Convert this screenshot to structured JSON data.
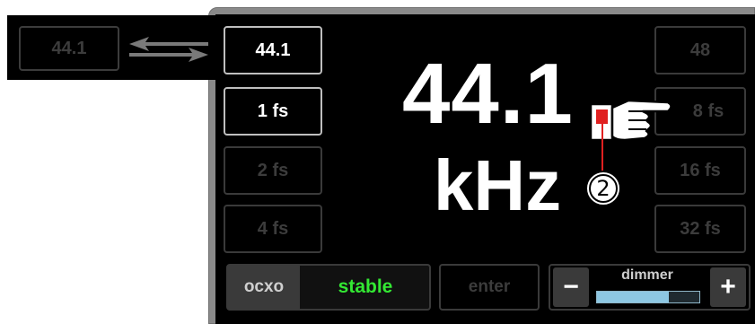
{
  "callout": {
    "source_rate": "44.1"
  },
  "rate_buttons_left": [
    {
      "label": "44.1",
      "state": "active"
    },
    {
      "label": "1 fs",
      "state": "active"
    },
    {
      "label": "2 fs",
      "state": "dim"
    },
    {
      "label": "4 fs",
      "state": "dim"
    }
  ],
  "rate_buttons_right": [
    {
      "label": "48",
      "state": "dim"
    },
    {
      "label": "8 fs",
      "state": "dim"
    },
    {
      "label": "16 fs",
      "state": "dim"
    },
    {
      "label": "32 fs",
      "state": "dim"
    }
  ],
  "display": {
    "frequency": "44.1",
    "unit": "kHz"
  },
  "bottom_bar": {
    "ocxo_label": "ocxo",
    "ocxo_status": "stable",
    "enter_label": "enter",
    "dimmer_label": "dimmer",
    "minus_label": "−",
    "plus_label": "+",
    "dimmer_level": 0.7
  },
  "annotation": {
    "step_number": "2"
  },
  "colors": {
    "status_ok": "#33e833",
    "dimmer_fill": "#8dc7e2",
    "pointer_line": "#e02020"
  },
  "icons": {
    "swap": "left-right-arrows-icon",
    "pointer": "pointing-hand-icon"
  }
}
